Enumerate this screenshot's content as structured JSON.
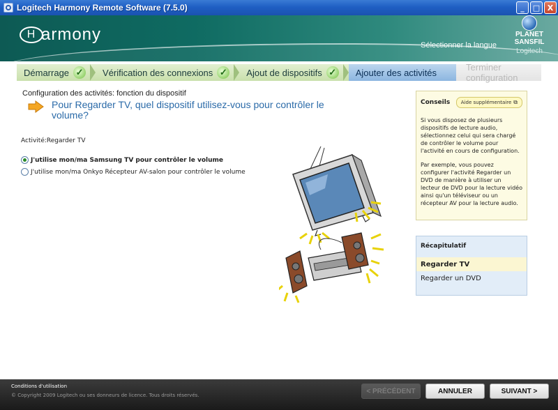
{
  "window": {
    "title": "Logitech Harmony Remote Software (7.5.0)",
    "buttons": {
      "minimize": "_",
      "maximize": "□",
      "close": "X"
    }
  },
  "header": {
    "logo_text": "armony",
    "logo_letter": "H",
    "language_link": "Sélectionner la langue",
    "watermark_line1": "PLANET",
    "watermark_line2": "SANSFIL",
    "brand": "Logitech"
  },
  "steps": [
    {
      "label": "Démarrage",
      "state": "done"
    },
    {
      "label": "Vérification des connexions",
      "state": "done"
    },
    {
      "label": "Ajout de dispositifs",
      "state": "done"
    },
    {
      "label": "Ajouter des activités",
      "state": "active"
    },
    {
      "label": "Terminer configuration",
      "state": "todo"
    }
  ],
  "main": {
    "section_title": "Configuration des activités: fonction du dispositif",
    "question": "Pour Regarder TV, quel dispositif utilisez-vous pour contrôler le volume?",
    "activity_label": "Activité:Regarder TV",
    "options": [
      {
        "label": "J'utilise mon/ma Samsung TV pour contrôler le volume",
        "selected": true
      },
      {
        "label": "J'utilise mon/ma Onkyo Récepteur AV-salon pour contrôler le volume",
        "selected": false
      }
    ]
  },
  "tips": {
    "title": "Conseils",
    "help_button": "Aide supplémentaire",
    "paragraph1": "Si vous disposez de plusieurs dispositifs de lecture audio, sélectionnez celui qui sera chargé de contrôler le volume pour l'activité en cours de configuration.",
    "paragraph2": "Par exemple, vous pouvez configurer l'activité Regarder un DVD de manière à utiliser un lecteur de DVD pour la lecture vidéo ainsi qu'un téléviseur ou un récepteur AV pour la lecture audio."
  },
  "recap": {
    "title": "Récapitulatif",
    "items": [
      {
        "label": "Regarder TV",
        "active": true
      },
      {
        "label": "Regarder un DVD",
        "active": false
      }
    ]
  },
  "footer": {
    "terms": "Conditions d'utilisation",
    "copyright": "© Copyright 2009 Logitech ou ses donneurs de licence. Tous droits réservés.",
    "prev": "< PRÉCÉDENT",
    "cancel": "ANNULER",
    "next": "SUIVANT >"
  },
  "colors": {
    "header_teal": "#0f6b62",
    "step_done": "#c9e0ac",
    "step_active": "#8cb6e0",
    "question_blue": "#2a6aa8",
    "tips_bg": "#fdfbe3",
    "recap_bg": "#e2edf8"
  }
}
